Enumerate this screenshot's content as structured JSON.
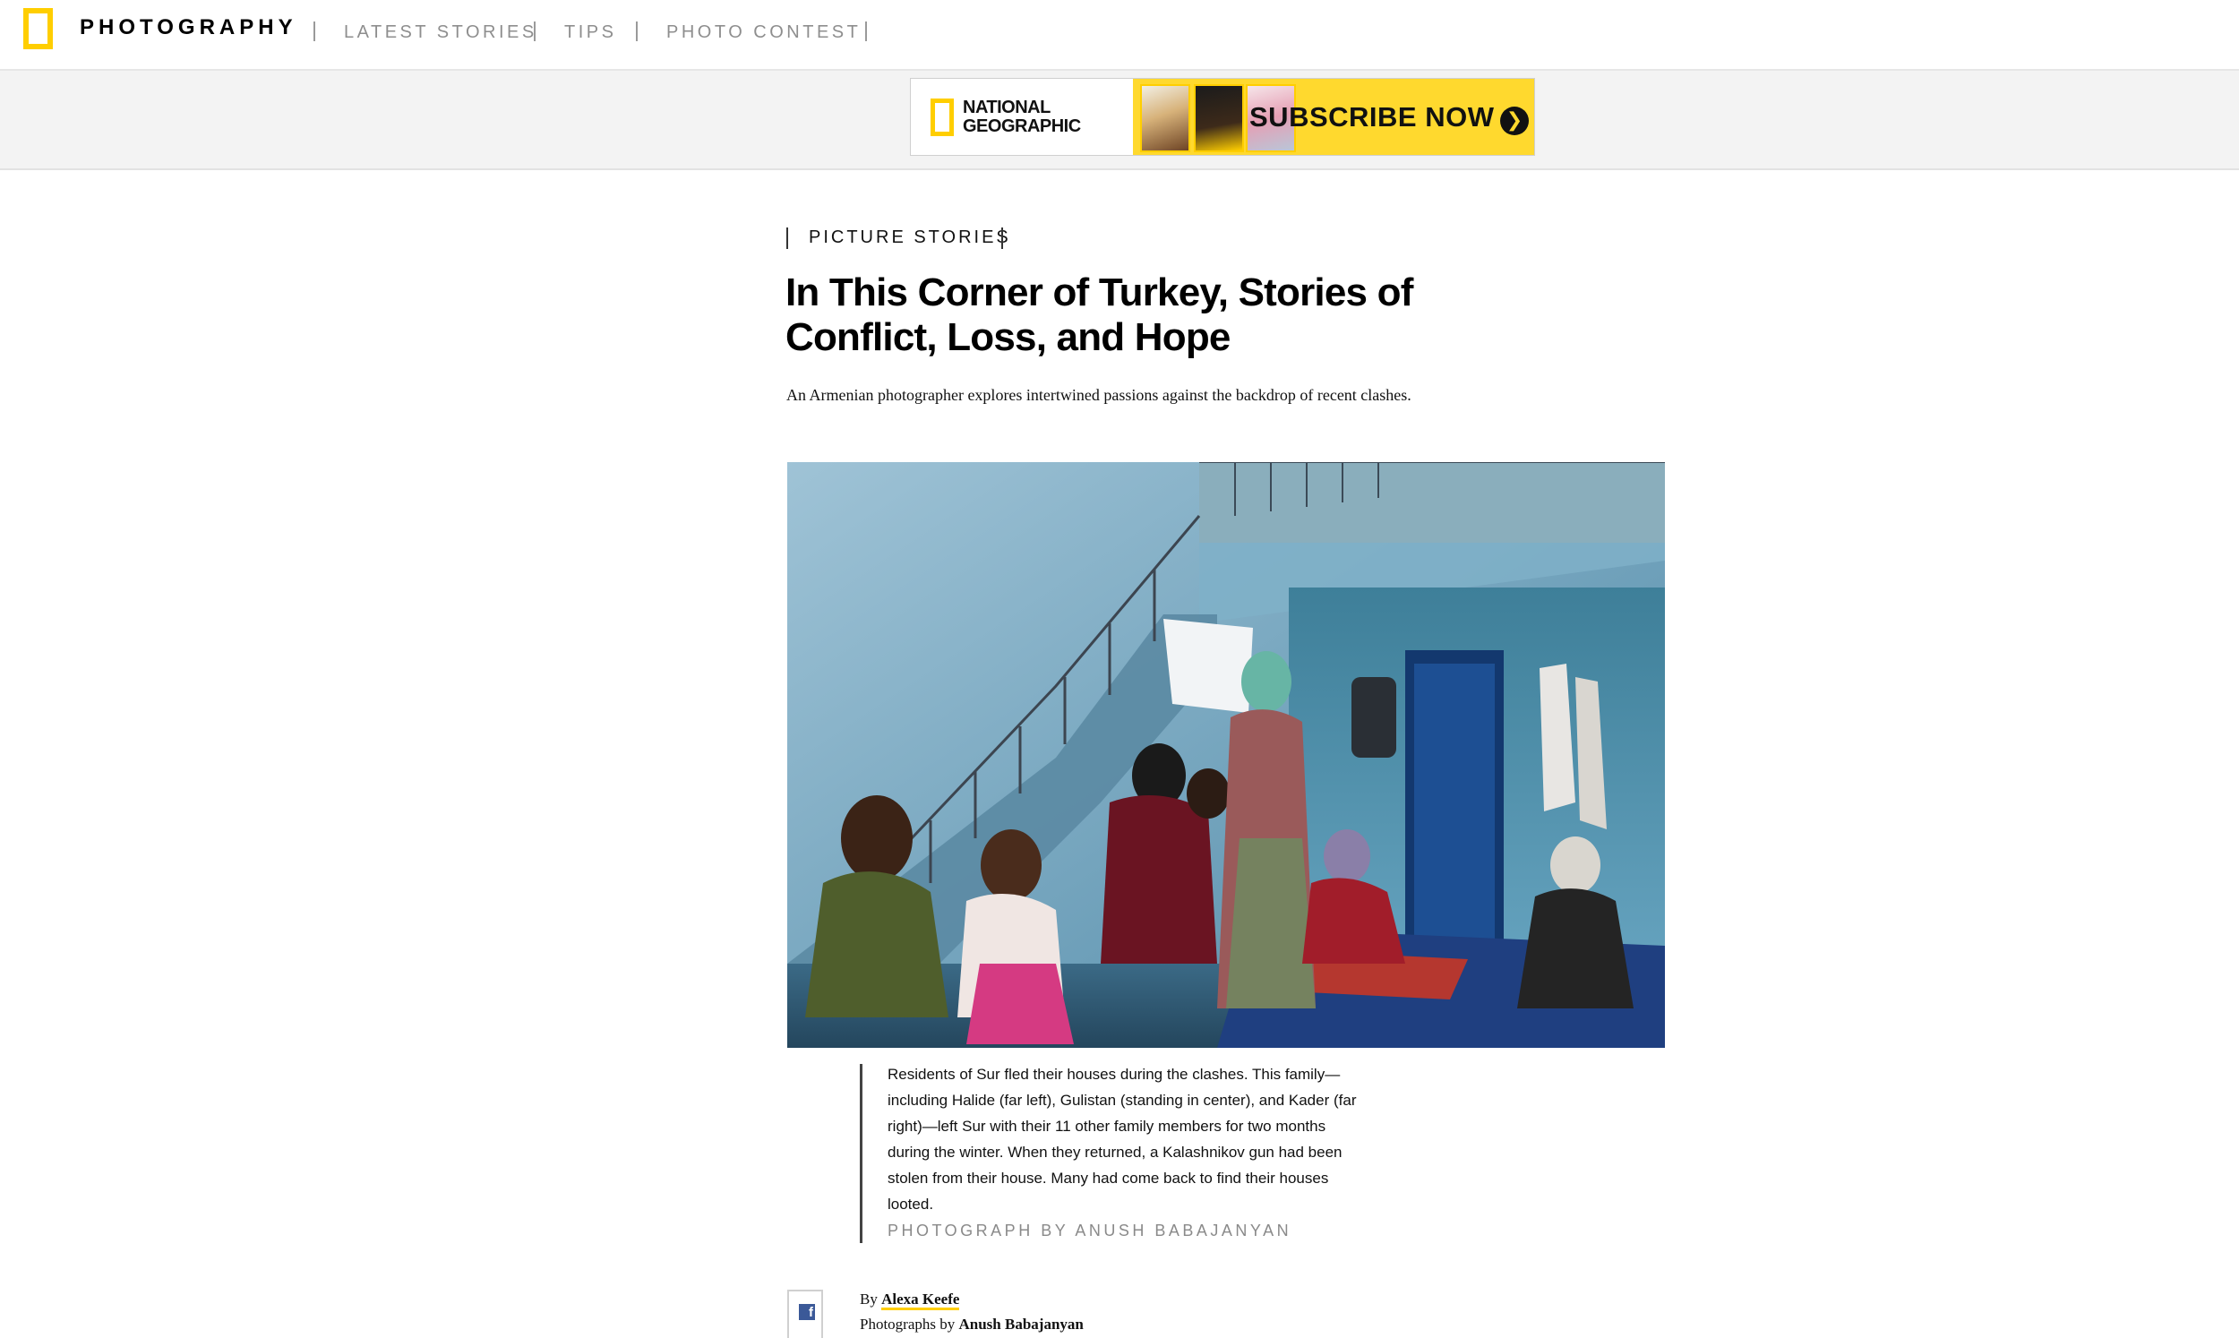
{
  "nav": {
    "brand": "PHOTOGRAPHY",
    "links": [
      "LATEST STORIES",
      "TIPS",
      "PHOTO CONTEST"
    ]
  },
  "ad": {
    "brand": "NATIONAL GEOGRAPHIC",
    "cta": "SUBSCRIBE NOW",
    "arrow": "❯",
    "icon": "arrow-right-circle-icon"
  },
  "article": {
    "kicker": "PICTURE STORIES",
    "headline": "In This Corner of Turkey, Stories of Conflict, Loss, and Hope",
    "dek": "An Armenian photographer explores intertwined passions against the backdrop of recent clashes.",
    "caption": "Residents of Sur fled their houses during the clashes. This family—including Halide (far left), Gulistan (standing in center), and Kader (far right)—left Sur with their 11 other family members for two months during the winter. When they returned, a Kalashnikov gun had been stolen from their house. Many had come back to find their houses looted.",
    "credit": "PHOTOGRAPH BY ANUSH BABAJANYAN",
    "byline": {
      "by_label": "By",
      "author": "Alexa Keefe",
      "photos_label": "Photographs by",
      "photographer": "Anush Babajanyan"
    }
  },
  "share": {
    "facebook_glyph": "f"
  },
  "colors": {
    "brand_yellow": "#ffce00",
    "ad_yellow": "#ffd92e",
    "facebook_blue": "#3b5998"
  }
}
